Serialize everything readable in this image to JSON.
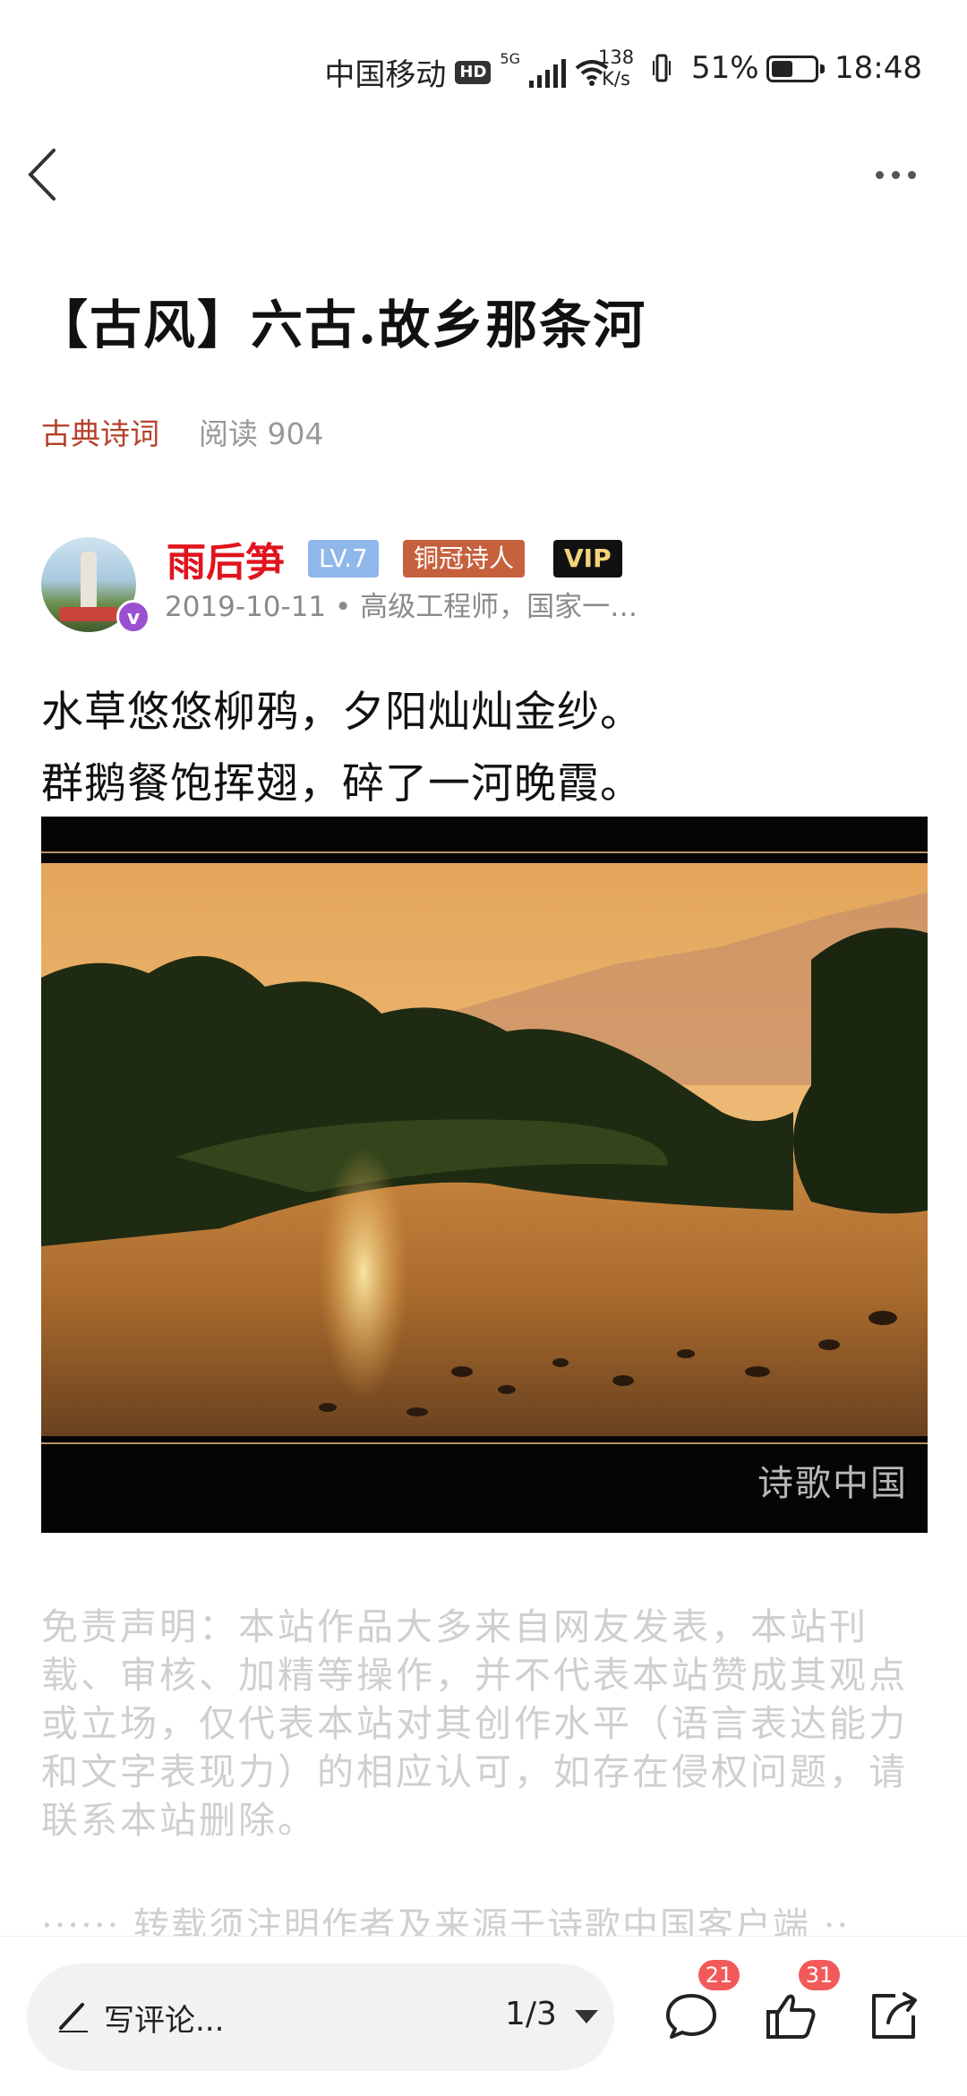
{
  "status_bar": {
    "carrier": "中国移动",
    "hd": "HD",
    "network": "5G",
    "speed_value": "138",
    "speed_unit": "K/s",
    "battery": "51%",
    "battery_level": 0.51,
    "time": "18:48"
  },
  "article": {
    "title": "【古风】六古.故乡那条河",
    "category": "古典诗词",
    "read_count": "阅读 904"
  },
  "author": {
    "name": "雨后笋",
    "level": "LV.7",
    "rank": "铜冠诗人",
    "vip": "VIP",
    "verify_mark": "v",
    "subtitle": "2019-10-11 • 高级工程师，国家一…"
  },
  "poem": {
    "line1": "水草悠悠柳鸦，夕阳灿灿金纱。",
    "line2": "群鹅餐饱挥翅，碎了一河晚霞。"
  },
  "image": {
    "watermark": "诗歌中国"
  },
  "disclaimer": "免责声明：本站作品大多来自网友发表，本站刊载、审核、加精等操作，并不代表本站赞成其观点或立场，仅代表本站对其创作水平（语言表达能力和文字表现力）的相应认可，如存在侵权问题，请联系本站删除。",
  "repost_note": "······ 转载须注明作者及来源于诗歌中国客户端 ··",
  "bottom_bar": {
    "comment_placeholder": "写评论...",
    "page_indicator": "1/3",
    "comment_count": "21",
    "like_count": "31"
  },
  "icons": [
    "back-icon",
    "more-icon",
    "pen-icon",
    "caret-down-icon",
    "comment-icon",
    "like-icon",
    "share-icon"
  ]
}
